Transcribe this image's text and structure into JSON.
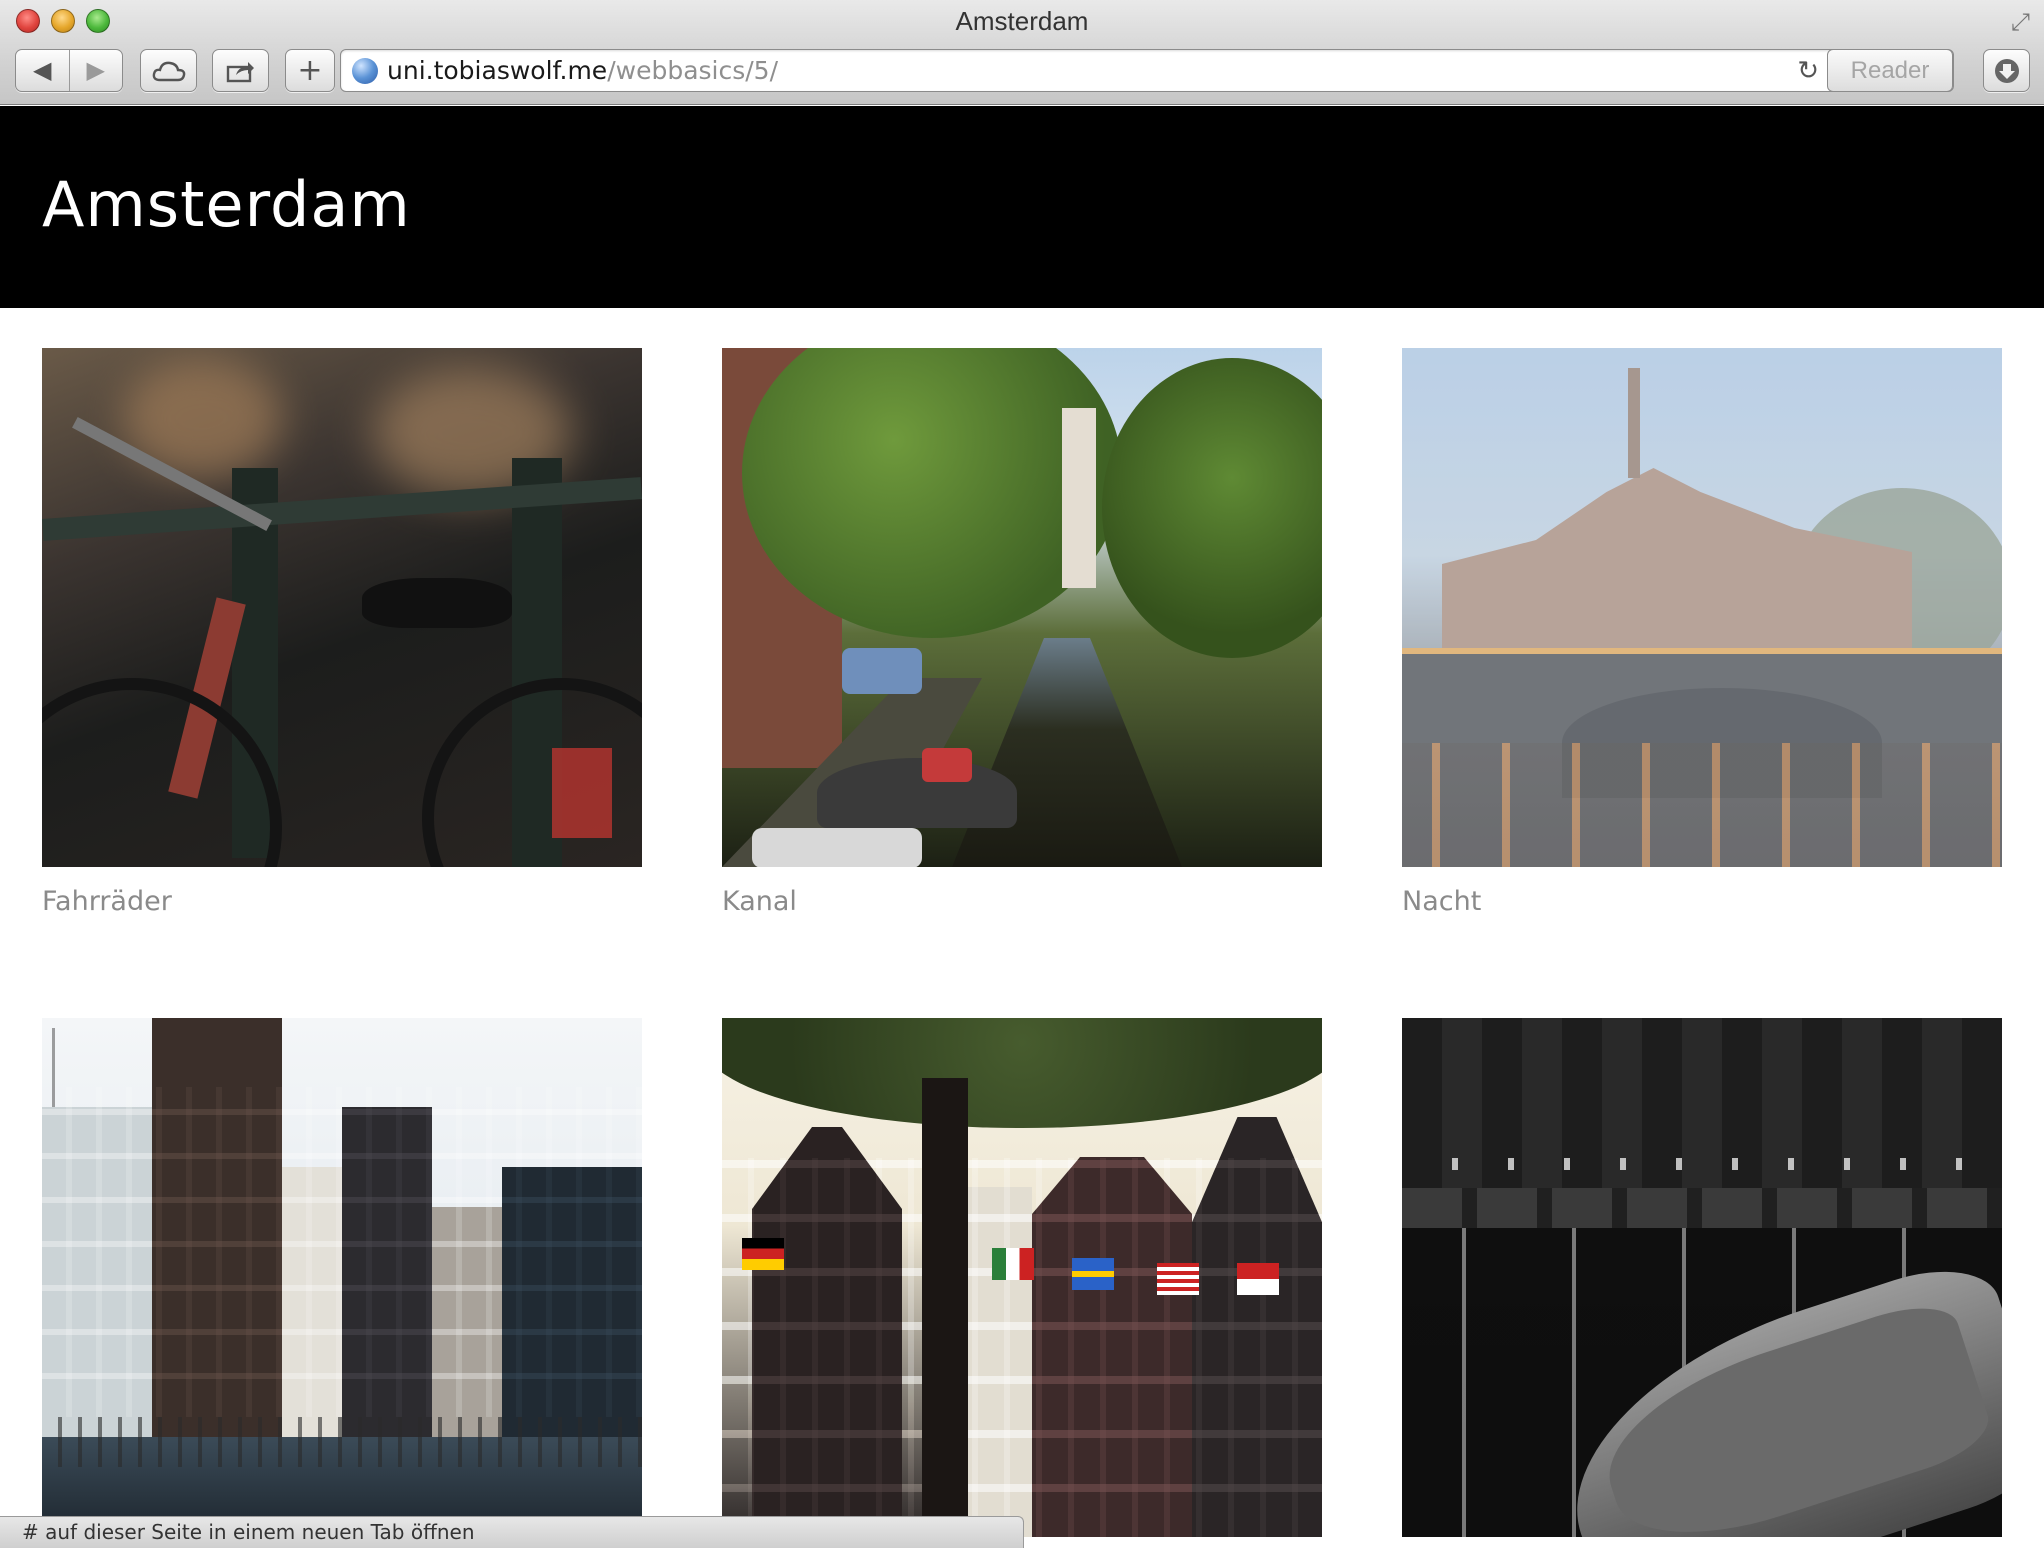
{
  "window": {
    "title": "Amsterdam",
    "fullscreen_icon": "fullscreen-arrows-icon"
  },
  "toolbar": {
    "back_icon": "back-arrow-icon",
    "forward_icon": "forward-arrow-icon",
    "cloud_icon": "icloud-tabs-icon",
    "share_icon": "share-icon",
    "add_label": "+",
    "reload_icon": "reload-icon",
    "reader_label": "Reader",
    "download_icon": "download-icon"
  },
  "address": {
    "host": "uni.tobiaswolf.me",
    "path": "/webbasics/5/"
  },
  "page": {
    "title": "Amsterdam"
  },
  "gallery": [
    {
      "caption": "Fahrräder"
    },
    {
      "caption": "Kanal"
    },
    {
      "caption": "Nacht"
    },
    {
      "caption": ""
    },
    {
      "caption": ""
    },
    {
      "caption": ""
    }
  ],
  "status_bar": {
    "text": "# auf dieser Seite in einem neuen Tab öffnen"
  },
  "colors": {
    "header_bg": "#000000",
    "header_text": "#ffffff",
    "caption_text": "#8a8a8a"
  }
}
